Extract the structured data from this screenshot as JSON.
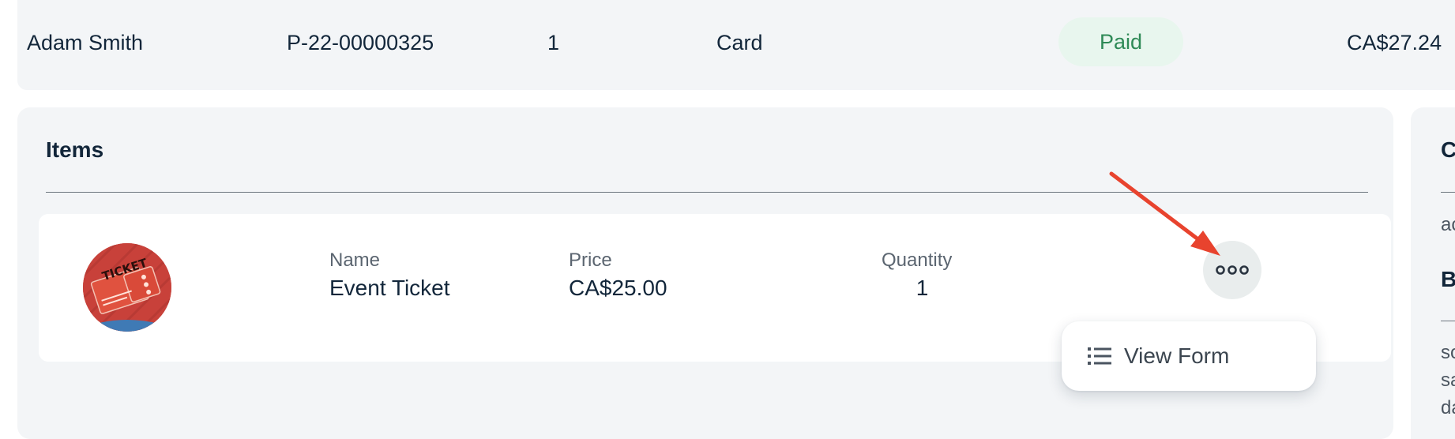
{
  "order": {
    "customer_name": "Adam Smith",
    "order_number": "P-22-00000325",
    "item_count": "1",
    "payment_method": "Card",
    "status": "Paid",
    "total": "CA$27.24"
  },
  "items_panel": {
    "title": "Items",
    "items": [
      {
        "thumbnail_text": "TICKET",
        "name_label": "Name",
        "name": "Event Ticket",
        "price_label": "Price",
        "price": "CA$25.00",
        "quantity_label": "Quantity",
        "quantity": "1"
      }
    ],
    "more_button_icon": "more-dots-icon",
    "menu": {
      "icon": "list-icon",
      "view_form_label": "View Form"
    }
  },
  "side_panel": {
    "title": "C",
    "text_1": "ac",
    "subtitle": "B",
    "text_2": "so",
    "text_3": "sa",
    "text_4": "da"
  },
  "colors": {
    "panel_bg": "#f3f5f7",
    "text": "#12263a",
    "status_paid_bg": "#e8f6ee",
    "status_paid_text": "#2f8a57",
    "annotation_arrow": "#e8432e"
  }
}
